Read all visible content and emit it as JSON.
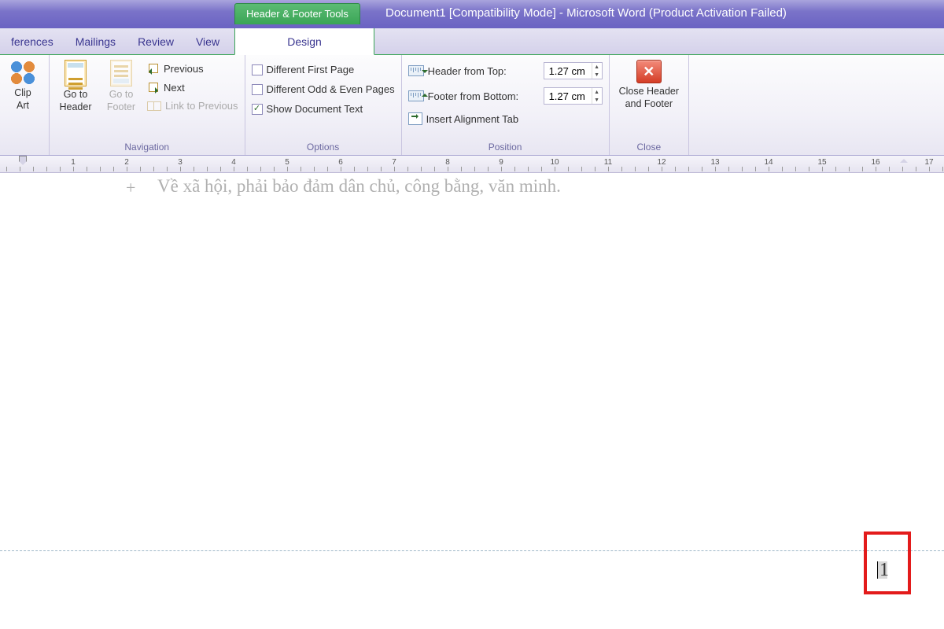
{
  "title": {
    "context_tab": "Header & Footer Tools",
    "document": "Document1 [Compatibility Mode]  -  Microsoft Word (Product Activation Failed)"
  },
  "tabs": {
    "references": "ferences",
    "mailings": "Mailings",
    "review": "Review",
    "view": "View",
    "design": "Design"
  },
  "ribbon": {
    "clipart": {
      "label1": "Clip",
      "label2": "Art"
    },
    "goto_header": {
      "label1": "Go to",
      "label2": "Header"
    },
    "goto_footer": {
      "label1": "Go to",
      "label2": "Footer"
    },
    "previous": "Previous",
    "next": "Next",
    "link_prev": "Link to Previous",
    "navigation_group": "Navigation",
    "diff_first": "Different First Page",
    "diff_odd_even": "Different Odd & Even Pages",
    "show_doc_text": "Show Document Text",
    "show_doc_checked": "✓",
    "options_group": "Options",
    "header_from_top": "Header from Top:",
    "header_value": "1.27 cm",
    "footer_from_bottom": "Footer from Bottom:",
    "footer_value": "1.27 cm",
    "insert_align_tab": "Insert Alignment Tab",
    "position_group": "Position",
    "close_label1": "Close Header",
    "close_label2": "and Footer",
    "close_group": "Close"
  },
  "ruler_numbers": [
    "1",
    "2",
    "3",
    "4",
    "5",
    "6",
    "7",
    "8",
    "9",
    "10",
    "11",
    "12",
    "13",
    "14",
    "15",
    "16",
    "17"
  ],
  "document": {
    "faded_bullet": "+",
    "faded_text": "Về xã hội, phải bảo đảm dân chủ, công bằng, văn minh.",
    "page_number": "1"
  }
}
